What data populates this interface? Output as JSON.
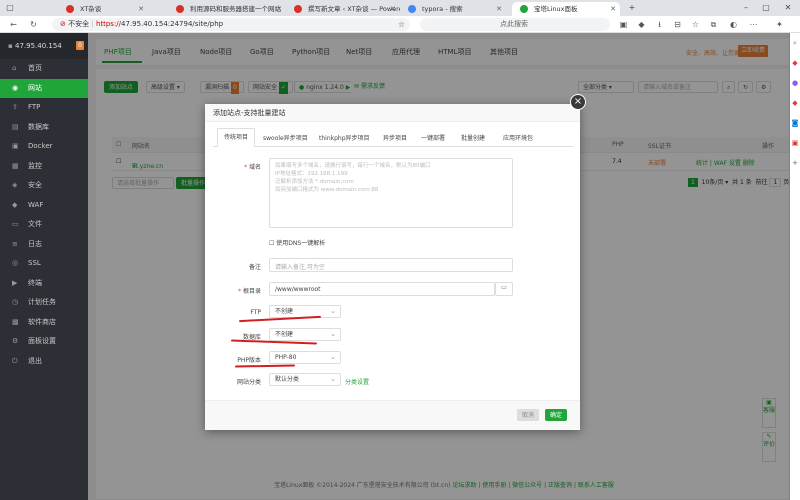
{
  "browser": {
    "tabs": [
      {
        "label": "XT杂谈",
        "color": "#d93025"
      },
      {
        "label": "利用源码和服务器搭建一个网站",
        "color": "#d93025"
      },
      {
        "label": "撰写新文章 ‹ XT杂谈 — Powered",
        "color": "#d93025"
      },
      {
        "label": "typora - 搜索",
        "color": "#4285f4"
      },
      {
        "label": "宝塔Linux面板",
        "color": "#20a53a"
      }
    ],
    "insecure_label": "不安全",
    "url_scheme": "https://",
    "url_rest": "47.95.40.154:24794/site/php",
    "search_placeholder": "点此搜索"
  },
  "sidebar": {
    "ip": "47.95.40.154",
    "badge": "0",
    "items": [
      {
        "label": "首页",
        "icon": "⌂"
      },
      {
        "label": "网站",
        "icon": "◉"
      },
      {
        "label": "FTP",
        "icon": "⇪"
      },
      {
        "label": "数据库",
        "icon": "▤"
      },
      {
        "label": "Docker",
        "icon": "▣"
      },
      {
        "label": "监控",
        "icon": "▦"
      },
      {
        "label": "安全",
        "icon": "◈"
      },
      {
        "label": "WAF",
        "icon": "◆"
      },
      {
        "label": "文件",
        "icon": "▭"
      },
      {
        "label": "日志",
        "icon": "≡"
      },
      {
        "label": "SSL",
        "icon": "◎"
      },
      {
        "label": "终端",
        "icon": "▶"
      },
      {
        "label": "计划任务",
        "icon": "◷"
      },
      {
        "label": "软件商店",
        "icon": "▩"
      },
      {
        "label": "面板设置",
        "icon": "⚙"
      },
      {
        "label": "退出",
        "icon": "⏻"
      }
    ]
  },
  "topnav": {
    "tabs": [
      "PHP项目",
      "Java项目",
      "Node项目",
      "Go项目",
      "Python项目",
      "Net项目",
      "应用代理",
      "HTML项目",
      "其他项目"
    ],
    "right_msg": "安全、高效、让您更放心",
    "pay_label": "立即续费"
  },
  "toolbar": {
    "add_site": "添加站点",
    "advanced": "高级设置",
    "scan": "漏洞扫描",
    "scan_badge": "0",
    "site_security": "网站安全",
    "nginx": "nginx 1.24.0",
    "feedback": "需求反馈",
    "category": "全部分类",
    "search_placeholder": "请输入域名或备注"
  },
  "table": {
    "headers": [
      "网站名",
      "PHP",
      "SSL证书",
      "操作"
    ],
    "row": {
      "name": "xt.yzne.cn",
      "php": "7.4",
      "ssl": "未部署",
      "actions": "统计 | WAF 设置 删除"
    },
    "batch": "请选择批量操作",
    "batch_btn": "批量操作"
  },
  "pager": {
    "page": "1",
    "per_page": "10条/页",
    "total": "共 1 条",
    "goto_label": "前往",
    "goto_page": "1",
    "page_unit": "页"
  },
  "modal": {
    "title": "添加站点-支持批量建站",
    "close": "×",
    "tabs": [
      "传统项目",
      "swoole异步项目",
      "thinkphp异步项目",
      "异步项目",
      "一键部署",
      "批量创建",
      "应用环境包"
    ],
    "domain_label": "域名",
    "domain_placeholder_lines": [
      "如果填写多个域名，请换行填写，每行一个域名，默认为80端口",
      "IP地址格式：192.168.1.199",
      "泛解析添加方法 *.domain.com",
      "如另加端口格式为 www.domain.com:88"
    ],
    "dns_label": "使用DNS一键解析",
    "remark_label": "备注",
    "remark_placeholder": "请输入备注,可为空",
    "root_label": "根目录",
    "root_value": "/www/wwwroot",
    "ftp_label": "FTP",
    "ftp_value": "不创建",
    "db_label": "数据库",
    "db_value": "不创建",
    "php_label": "PHP版本",
    "php_value": "PHP-80",
    "cat_label": "网站分类",
    "cat_value": "默认分类",
    "cat_link": "分类设置",
    "cancel": "取消",
    "ok": "确定"
  },
  "footer": {
    "copy": "宝塔Linux面板 ©2014-2024 广东堡塔安全技术有限公司 (bt.cn)",
    "links": [
      "论坛求助",
      "使用手册",
      "微信公众号",
      "正版查询",
      "联系人工客服"
    ]
  },
  "float": {
    "service": "客服",
    "review": "评价"
  },
  "colors": {
    "brand": "#20a53a",
    "accent": "#e8823a",
    "annotation": "#d21f1f",
    "sidebar": "#2c2f35"
  }
}
